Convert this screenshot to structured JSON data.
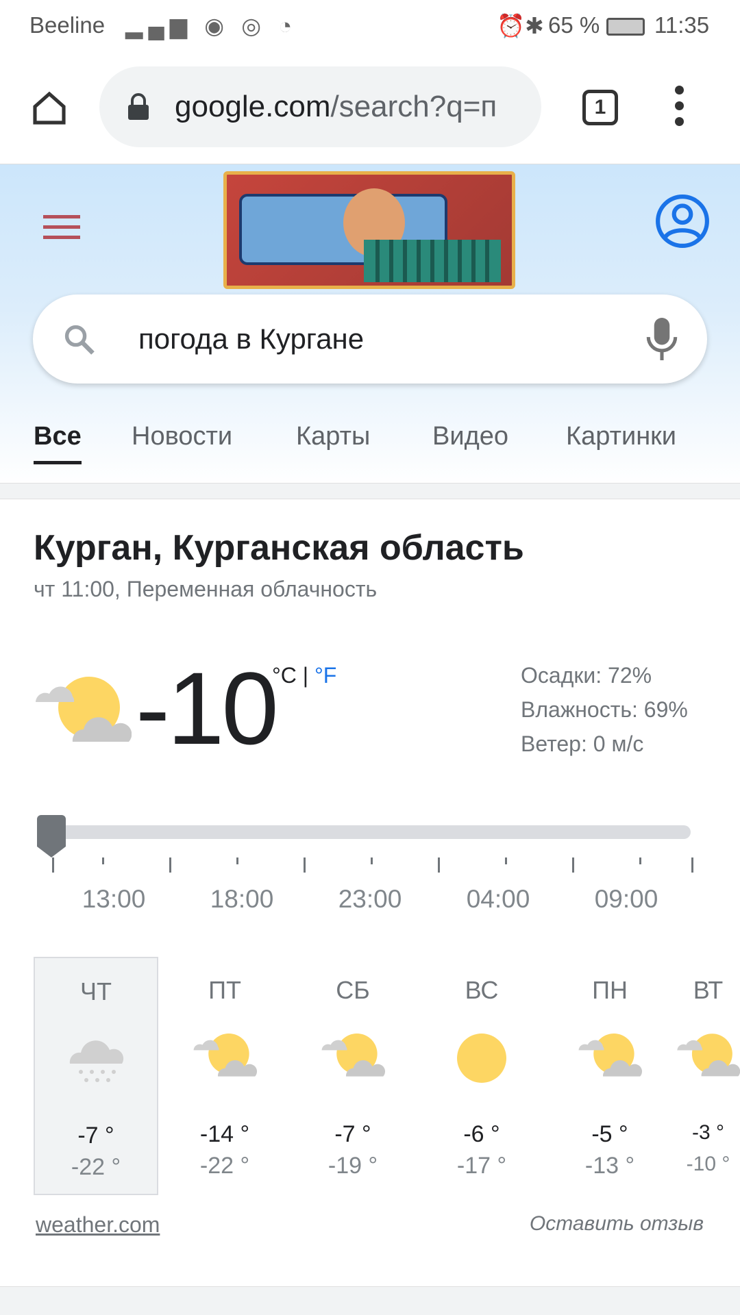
{
  "status_bar": {
    "carrier": "Beeline",
    "battery": "65 %",
    "time": "11:35"
  },
  "browser": {
    "url_host": "google.com",
    "url_path": "/search?q=п",
    "tab_count": "1"
  },
  "search": {
    "query": "погода в Кургане"
  },
  "tabs": [
    {
      "label": "Все",
      "active": true
    },
    {
      "label": "Новости"
    },
    {
      "label": "Карты"
    },
    {
      "label": "Видео"
    },
    {
      "label": "Картинки"
    }
  ],
  "weather": {
    "location": "Курган, Курганская область",
    "subtitle": "чт 11:00, Переменная облачность",
    "temp": "-10",
    "unit_c": "°C",
    "unit_sep": "|",
    "unit_f": "°F",
    "precip": "Осадки: 72%",
    "humidity": "Влажность: 69%",
    "wind": "Ветер: 0 м/с",
    "slider_position": 0,
    "times": [
      "13:00",
      "18:00",
      "23:00",
      "04:00",
      "09:00"
    ],
    "days": [
      {
        "name": "ЧТ",
        "icon": "snow-cloud",
        "hi": "-7 °",
        "lo": "-22 °",
        "selected": true
      },
      {
        "name": "ПТ",
        "icon": "partly-cloudy",
        "hi": "-14 °",
        "lo": "-22 °"
      },
      {
        "name": "СБ",
        "icon": "partly-cloudy",
        "hi": "-7 °",
        "lo": "-19 °"
      },
      {
        "name": "ВС",
        "icon": "sunny",
        "hi": "-6 °",
        "lo": "-17 °"
      },
      {
        "name": "ПН",
        "icon": "partly-cloudy",
        "hi": "-5 °",
        "lo": "-13 °"
      },
      {
        "name": "ВТ",
        "icon": "partly-cloudy",
        "hi": "-3 °",
        "lo": "-10 °"
      }
    ],
    "source": "weather.com",
    "feedback": "Оставить отзыв"
  },
  "colors": {
    "accent": "#1a73e8",
    "sun": "#fdd663",
    "cloud": "#c8c8c8"
  }
}
